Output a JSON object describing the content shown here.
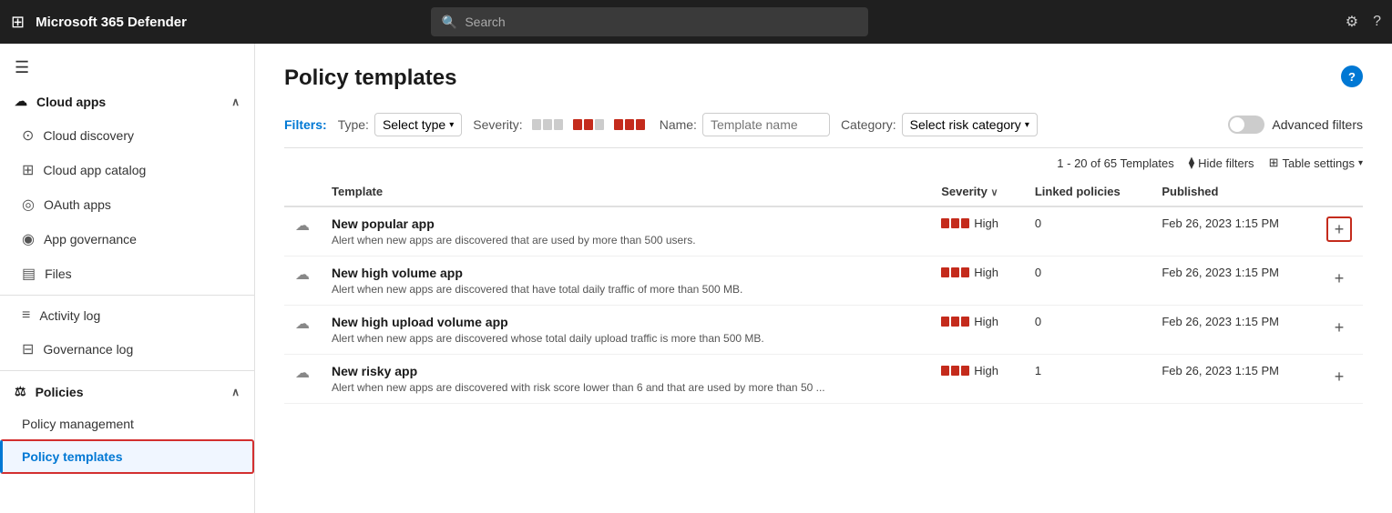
{
  "app": {
    "title": "Microsoft 365 Defender"
  },
  "search": {
    "placeholder": "Search"
  },
  "sidebar": {
    "hamburger_icon": "☰",
    "sections": [
      {
        "id": "cloud-apps",
        "label": "Cloud apps",
        "expanded": true,
        "items": [
          {
            "id": "cloud-discovery",
            "label": "Cloud discovery",
            "icon": "🔍"
          },
          {
            "id": "cloud-app-catalog",
            "label": "Cloud app catalog",
            "icon": "📋"
          },
          {
            "id": "oauth-apps",
            "label": "OAuth apps",
            "icon": "🔗"
          },
          {
            "id": "app-governance",
            "label": "App governance",
            "icon": "🛡️"
          },
          {
            "id": "files",
            "label": "Files",
            "icon": "📄"
          }
        ]
      },
      {
        "id": "activity-log",
        "label": "Activity log",
        "icon": "📊",
        "standalone": true
      },
      {
        "id": "governance-log",
        "label": "Governance log",
        "icon": "📝",
        "standalone": true
      },
      {
        "id": "policies",
        "label": "Policies",
        "expanded": true,
        "items": [
          {
            "id": "policy-management",
            "label": "Policy management",
            "icon": ""
          },
          {
            "id": "policy-templates",
            "label": "Policy templates",
            "icon": "",
            "active": true
          }
        ]
      }
    ]
  },
  "page": {
    "title": "Policy templates",
    "help_label": "?",
    "filters_label": "Filters:",
    "type_filter": {
      "label": "Type:",
      "value": "Select type"
    },
    "severity_filter": {
      "label": "Severity:"
    },
    "name_filter": {
      "label": "Name:",
      "placeholder": "Template name"
    },
    "category_filter": {
      "label": "Category:",
      "value": "Select risk category"
    },
    "advanced_filters_label": "Advanced filters",
    "table_count": "1 - 20 of 65 Templates",
    "hide_filters_label": "Hide filters",
    "table_settings_label": "Table settings",
    "columns": {
      "template": "Template",
      "severity": "Severity",
      "linked_policies": "Linked policies",
      "published": "Published"
    },
    "rows": [
      {
        "name": "New popular app",
        "description": "Alert when new apps are discovered that are used by more than 500 users.",
        "severity": "High",
        "linked_policies": "0",
        "published": "Feb 26, 2023 1:15 PM",
        "highlight_add": true
      },
      {
        "name": "New high volume app",
        "description": "Alert when new apps are discovered that have total daily traffic of more than 500 MB.",
        "severity": "High",
        "linked_policies": "0",
        "published": "Feb 26, 2023 1:15 PM",
        "highlight_add": false
      },
      {
        "name": "New high upload volume app",
        "description": "Alert when new apps are discovered whose total daily upload traffic is more than 500 MB.",
        "severity": "High",
        "linked_policies": "0",
        "published": "Feb 26, 2023 1:15 PM",
        "highlight_add": false
      },
      {
        "name": "New risky app",
        "description": "Alert when new apps are discovered with risk score lower than 6 and that are used by more than 50 ...",
        "severity": "High",
        "linked_policies": "1",
        "published": "Feb 26, 2023 1:15 PM",
        "highlight_add": false
      }
    ]
  }
}
